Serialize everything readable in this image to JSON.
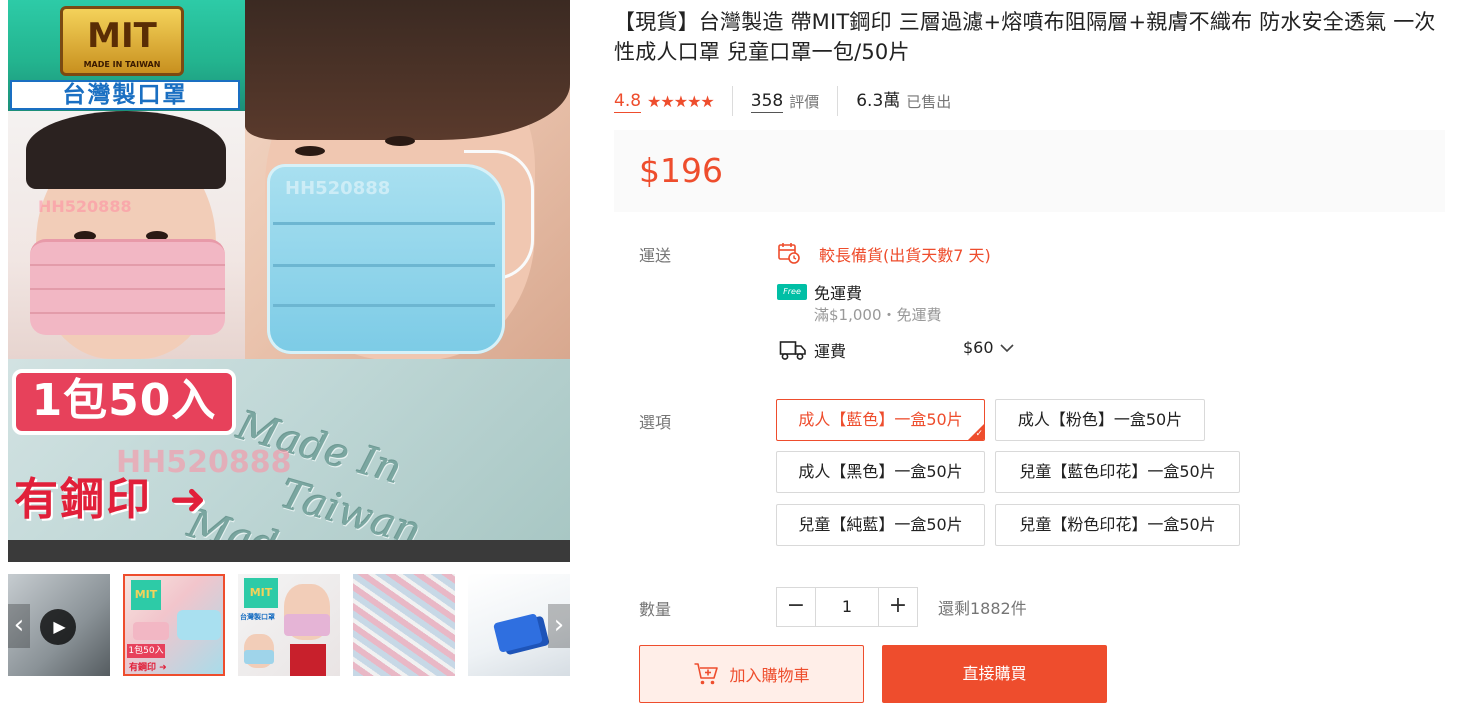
{
  "gallery": {
    "badge_text": "MIT",
    "badge_small": "MADE IN TAIWAN",
    "banner_text": "台灣製口罩",
    "pack_text": "1包50入",
    "stamp_text": "有鋼印",
    "arrow_glyph": "➜",
    "emboss_line1": "Made In",
    "emboss_line2": "Taiwan",
    "emboss_line3": "Made In Tai",
    "watermark": "HH520888"
  },
  "thumbnails": {
    "play_glyph": "▶",
    "prev_glyph": "‹",
    "next_glyph": "›",
    "mini_mit": "MIT",
    "mini_pack": "1包50入",
    "mini_stamp": "有鋼印 ➜",
    "mini_banner": "台灣製口罩",
    "active_index": 1
  },
  "product": {
    "title": "【現貨】台灣製造 帶MIT鋼印 三層過濾+熔噴布阻隔層+親膚不織布 防水安全透氣 一次性成人口罩 兒童口罩一包/50片",
    "rating": "4.8",
    "stars": "★★★★★",
    "review_count": "358",
    "review_label": "評價",
    "sold_count": "6.3萬",
    "sold_label": "已售出",
    "price": "$196"
  },
  "shipping": {
    "label": "運送",
    "preorder_text": "較長備貨(出貨天數7 天)",
    "free_badge": "Free",
    "free_title": "免運費",
    "free_sub": "滿$1,000・免運費",
    "fee_label": "運費",
    "fee_value": "$60"
  },
  "options": {
    "label": "選項",
    "items": [
      "成人【藍色】一盒50片",
      "成人【粉色】一盒50片",
      "成人【黑色】一盒50片",
      "兒童【藍色印花】一盒50片",
      "兒童【純藍】一盒50片",
      "兒童【粉色印花】一盒50片"
    ],
    "selected_index": 0
  },
  "quantity": {
    "label": "數量",
    "minus": "−",
    "plus": "+",
    "value": "1",
    "stock": "還剩1882件"
  },
  "actions": {
    "add_to_cart": "加入購物車",
    "buy_now": "直接購買"
  },
  "colors": {
    "accent": "#ee4d2d",
    "free_badge": "#00bfa5"
  }
}
